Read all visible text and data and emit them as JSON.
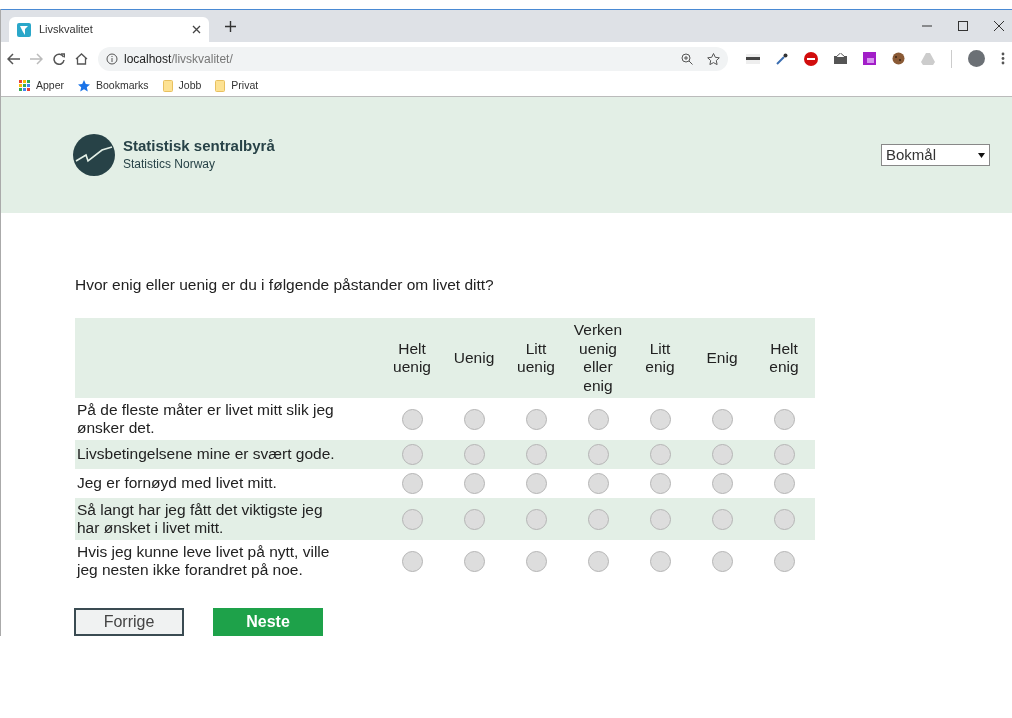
{
  "browser": {
    "tab_title": "Livskvalitet",
    "url_host": "localhost",
    "url_path": "/livskvalitet/",
    "bookmarks": [
      {
        "kind": "apps",
        "label": "Apper"
      },
      {
        "kind": "star",
        "label": "Bookmarks"
      },
      {
        "kind": "folder",
        "label": "Jobb"
      },
      {
        "kind": "folder",
        "label": "Privat"
      }
    ]
  },
  "header": {
    "org_name": "Statistisk sentralbyrå",
    "org_subtitle": "Statistics Norway",
    "language": "Bokmål"
  },
  "question": "Hvor enig eller uenig er du i følgende påstander om livet ditt?",
  "scale": [
    "Helt uenig",
    "Uenig",
    "Litt uenig",
    "Verken uenig eller enig",
    "Litt enig",
    "Enig",
    "Helt enig"
  ],
  "statements": [
    {
      "text": "På de fleste måter er livet mitt slik jeg ønsker det.",
      "options": [
        {
          "selected": false
        },
        {
          "selected": false
        },
        {
          "selected": false
        },
        {
          "selected": false
        },
        {
          "selected": false
        },
        {
          "selected": false
        },
        {
          "selected": false
        }
      ]
    },
    {
      "text": "Livsbetingelsene mine er svært gode.",
      "options": [
        {
          "selected": false
        },
        {
          "selected": false
        },
        {
          "selected": false
        },
        {
          "selected": false
        },
        {
          "selected": false
        },
        {
          "selected": false
        },
        {
          "selected": false
        }
      ]
    },
    {
      "text": "Jeg er fornøyd med livet mitt.",
      "options": [
        {
          "selected": false
        },
        {
          "selected": false
        },
        {
          "selected": false
        },
        {
          "selected": false
        },
        {
          "selected": false
        },
        {
          "selected": false
        },
        {
          "selected": false
        }
      ]
    },
    {
      "text": "Så langt har jeg fått det viktigste jeg har ønsket i livet mitt.",
      "options": [
        {
          "selected": false
        },
        {
          "selected": false
        },
        {
          "selected": false
        },
        {
          "selected": false
        },
        {
          "selected": false
        },
        {
          "selected": false
        },
        {
          "selected": false
        }
      ]
    },
    {
      "text": "Hvis jeg kunne leve livet på nytt, ville jeg nesten ikke forandret på noe.",
      "options": [
        {
          "selected": false
        },
        {
          "selected": false
        },
        {
          "selected": false
        },
        {
          "selected": false
        },
        {
          "selected": false
        },
        {
          "selected": false
        },
        {
          "selected": false
        }
      ]
    }
  ],
  "buttons": {
    "back": "Forrige",
    "next": "Neste"
  }
}
